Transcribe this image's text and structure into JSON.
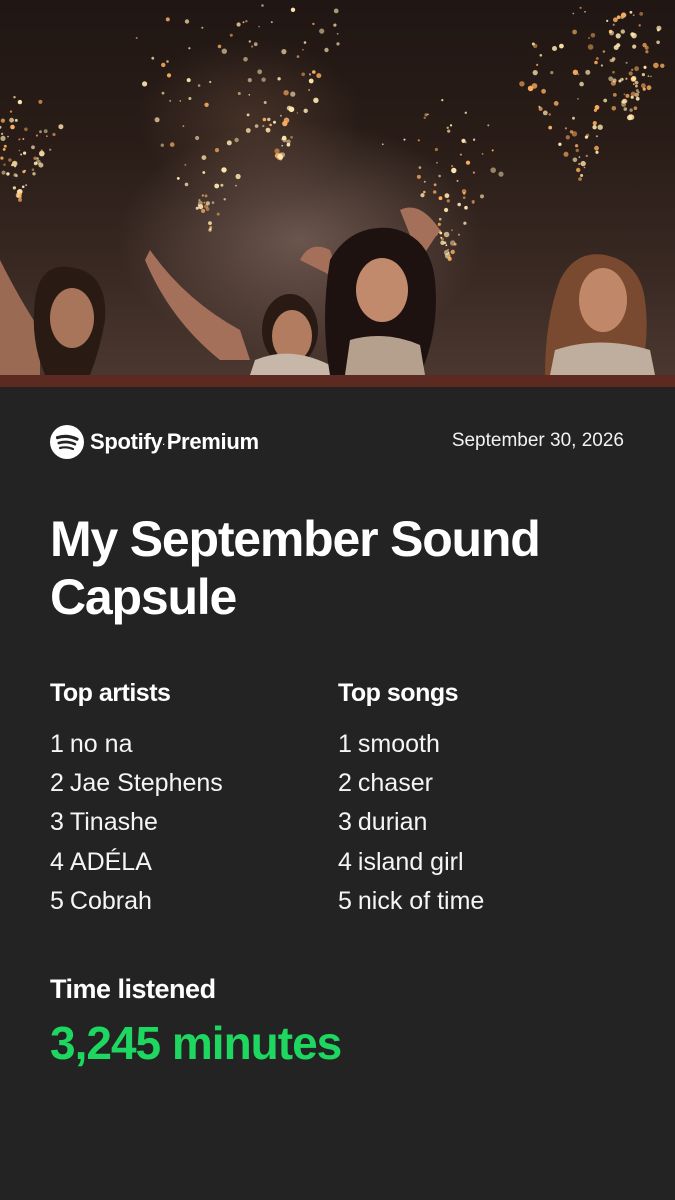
{
  "brand": {
    "name": "Spotify",
    "tm": ".",
    "tier": "Premium",
    "logo_icon": "spotify-logo-icon"
  },
  "date": "September 30, 2026",
  "title": "My September Sound Capsule",
  "top_artists": {
    "heading": "Top artists",
    "items": [
      {
        "rank": "1",
        "name": "no na"
      },
      {
        "rank": "2",
        "name": "Jae Stephens"
      },
      {
        "rank": "3",
        "name": "Tinashe"
      },
      {
        "rank": "4",
        "name": "ADÉLA"
      },
      {
        "rank": "5",
        "name": "Cobrah"
      }
    ]
  },
  "top_songs": {
    "heading": "Top songs",
    "items": [
      {
        "rank": "1",
        "name": "smooth"
      },
      {
        "rank": "2",
        "name": "chaser"
      },
      {
        "rank": "3",
        "name": "durian"
      },
      {
        "rank": "4",
        "name": "island girl"
      },
      {
        "rank": "5",
        "name": "nick of time"
      }
    ]
  },
  "time_listened": {
    "label": "Time listened",
    "value": "3,245 minutes"
  },
  "colors": {
    "background": "#232323",
    "accent_green": "#1ed760",
    "hero_strip": "#5c2a20",
    "text": "#ffffff"
  }
}
